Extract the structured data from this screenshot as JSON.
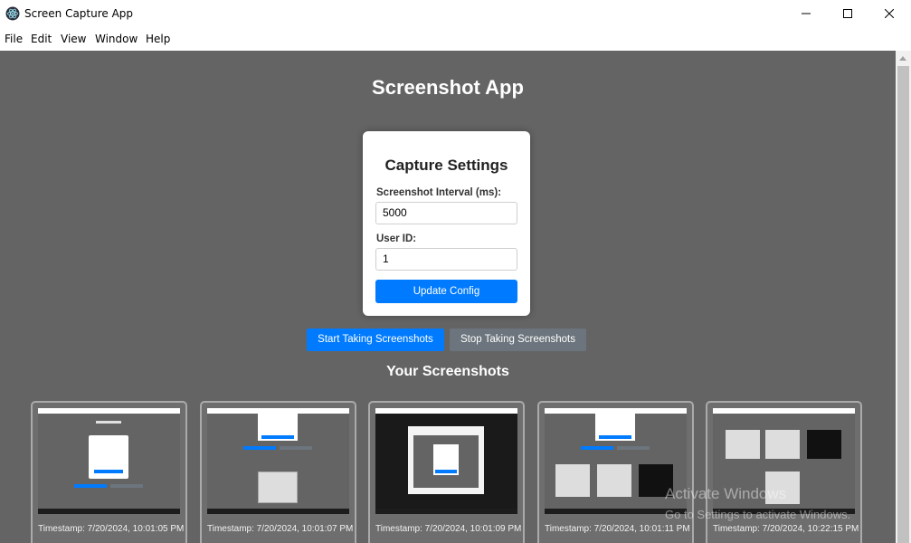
{
  "window": {
    "title": "Screen Capture App",
    "icon": "electron-icon"
  },
  "menu": {
    "items": [
      "File",
      "Edit",
      "View",
      "Window",
      "Help"
    ]
  },
  "page": {
    "title": "Screenshot App"
  },
  "settings": {
    "title": "Capture Settings",
    "interval_label": "Screenshot Interval (ms):",
    "interval_value": "5000",
    "user_label": "User ID:",
    "user_value": "1",
    "update_button": "Update Config"
  },
  "controls": {
    "start_button": "Start Taking Screenshots",
    "stop_button": "Stop Taking Screenshots"
  },
  "screenshots": {
    "title": "Your Screenshots",
    "items": [
      {
        "timestamp": "Timestamp: 7/20/2024, 10:01:05 PM"
      },
      {
        "timestamp": "Timestamp: 7/20/2024, 10:01:07 PM"
      },
      {
        "timestamp": "Timestamp: 7/20/2024, 10:01:09 PM"
      },
      {
        "timestamp": "Timestamp: 7/20/2024, 10:01:11 PM"
      },
      {
        "timestamp": "Timestamp: 7/20/2024, 10:22:15 PM"
      }
    ]
  },
  "watermark": {
    "line1": "Activate Windows",
    "line2": "Go to Settings to activate Windows."
  },
  "colors": {
    "background": "#646464",
    "primary": "#007bff",
    "secondary": "#6c757d"
  }
}
